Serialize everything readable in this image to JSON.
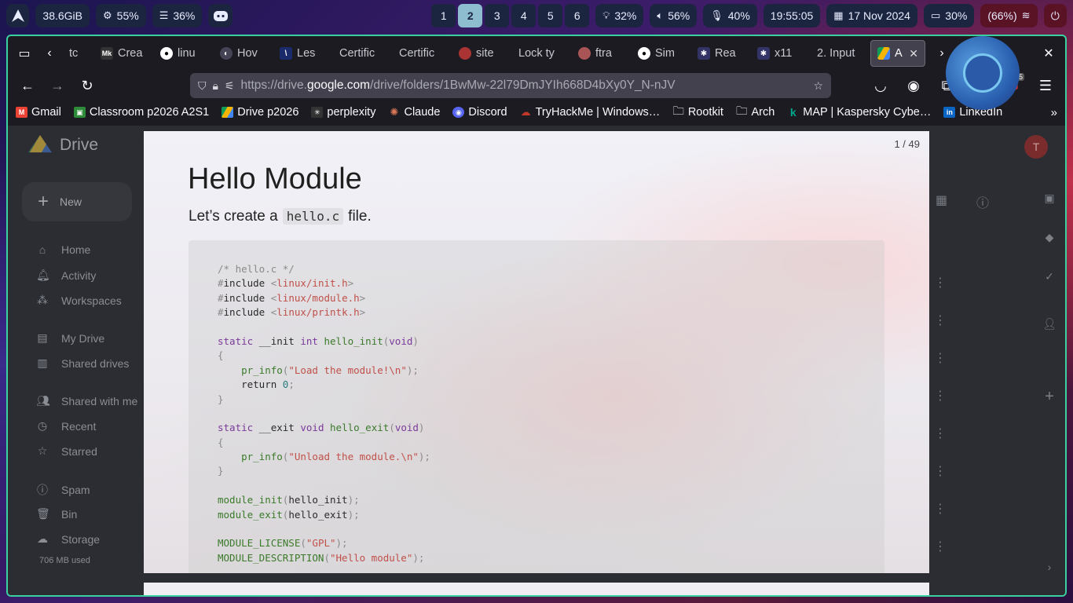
{
  "topbar": {
    "memory": "38.6GiB",
    "cpu": "55%",
    "ram": "36%",
    "workspaces": [
      "1",
      "2",
      "3",
      "4",
      "5",
      "6"
    ],
    "active_workspace": "2",
    "brightness": "32%",
    "volume": "56%",
    "mic": "40%",
    "time": "19:55:05",
    "date": "17 Nov 2024",
    "battery": "30%",
    "wifi": "(66%)"
  },
  "tabs": [
    {
      "label": "tc",
      "fav": "firefox-icon"
    },
    {
      "label": "Crea",
      "fav": "mk-icon"
    },
    {
      "label": "linu",
      "fav": "github-icon"
    },
    {
      "label": "Hov",
      "fav": "shield-icon"
    },
    {
      "label": "Les",
      "fav": "x-icon"
    },
    {
      "label": "Certific",
      "fav": ""
    },
    {
      "label": "Certific",
      "fav": ""
    },
    {
      "label": "site",
      "fav": "site-icon"
    },
    {
      "label": "Lock ty",
      "fav": ""
    },
    {
      "label": "ftra",
      "fav": "site-icon"
    },
    {
      "label": "Sim",
      "fav": "github-icon"
    },
    {
      "label": "Rea",
      "fav": "bug-icon"
    },
    {
      "label": "x11",
      "fav": "bug-icon"
    },
    {
      "label": "2. Input",
      "fav": ""
    },
    {
      "label": "A",
      "fav": "drive-icon",
      "active": true
    }
  ],
  "url": {
    "prefix": "https://drive.",
    "domain": "google.com",
    "path": "/drive/folders/1BwMw-22l79DmJYIh668D4bXy0Y_N-nJV"
  },
  "extension_badge": "75",
  "bookmarks": [
    {
      "label": "Gmail",
      "color": "#ea4335",
      "glyph": "M"
    },
    {
      "label": "Classroom p2026 A2S1",
      "color": "#2e8b3a",
      "glyph": "▣"
    },
    {
      "label": "Drive p2026",
      "color": "#f4b400",
      "glyph": "▲"
    },
    {
      "label": "perplexity",
      "color": "#333333",
      "glyph": "✳"
    },
    {
      "label": "Claude",
      "color": "#d97757",
      "glyph": "✺"
    },
    {
      "label": "Discord",
      "color": "#5865f2",
      "glyph": "◉"
    },
    {
      "label": "TryHackMe | Windows…",
      "color": "#c0392b",
      "glyph": "☁"
    },
    {
      "label": "Rootkit",
      "color": "",
      "glyph": "🗀"
    },
    {
      "label": "Arch",
      "color": "",
      "glyph": "🗀"
    },
    {
      "label": "MAP | Kaspersky Cybe…",
      "color": "#009982",
      "glyph": "k"
    },
    {
      "label": "LinkedIn",
      "color": "#0a66c2",
      "glyph": "in"
    }
  ],
  "drive": {
    "brand": "Drive",
    "new_label": "New",
    "nav": [
      "Home",
      "Activity",
      "Workspaces",
      "My Drive",
      "Shared drives",
      "Shared with me",
      "Recent",
      "Starred",
      "Spam",
      "Bin",
      "Storage"
    ],
    "storage_used": "706 MB used",
    "avatar_letter": "T"
  },
  "slide": {
    "counter": "1 / 49",
    "title": "Hello Module",
    "subtitle_pre": "Let’s create a",
    "subtitle_code": "hello.c",
    "subtitle_post": "file.",
    "code_lines": [
      [
        {
          "t": "/* hello.c */",
          "c": "com"
        }
      ],
      [
        {
          "t": "#",
          "c": "pp"
        },
        {
          "t": "include",
          "c": "plain"
        },
        {
          "t": " <",
          "c": "pp"
        },
        {
          "t": "linux/init.h",
          "c": "str"
        },
        {
          "t": ">",
          "c": "pp"
        }
      ],
      [
        {
          "t": "#",
          "c": "pp"
        },
        {
          "t": "include",
          "c": "plain"
        },
        {
          "t": " <",
          "c": "pp"
        },
        {
          "t": "linux/module.h",
          "c": "str"
        },
        {
          "t": ">",
          "c": "pp"
        }
      ],
      [
        {
          "t": "#",
          "c": "pp"
        },
        {
          "t": "include",
          "c": "plain"
        },
        {
          "t": " <",
          "c": "pp"
        },
        {
          "t": "linux/printk.h",
          "c": "str"
        },
        {
          "t": ">",
          "c": "pp"
        }
      ],
      [
        {
          "t": "",
          "c": "plain"
        }
      ],
      [
        {
          "t": "static",
          "c": "kw"
        },
        {
          "t": " __init ",
          "c": "plain"
        },
        {
          "t": "int",
          "c": "kw"
        },
        {
          "t": " ",
          "c": "plain"
        },
        {
          "t": "hello_init",
          "c": "fn"
        },
        {
          "t": "(",
          "c": "pp"
        },
        {
          "t": "void",
          "c": "kw"
        },
        {
          "t": ")",
          "c": "pp"
        }
      ],
      [
        {
          "t": "{",
          "c": "pp"
        }
      ],
      [
        {
          "t": "    ",
          "c": "plain"
        },
        {
          "t": "pr_info",
          "c": "fn"
        },
        {
          "t": "(",
          "c": "pp"
        },
        {
          "t": "\"Load the module!\\n\"",
          "c": "str"
        },
        {
          "t": ");",
          "c": "pp"
        }
      ],
      [
        {
          "t": "    return ",
          "c": "plain"
        },
        {
          "t": "0",
          "c": "num"
        },
        {
          "t": ";",
          "c": "pp"
        }
      ],
      [
        {
          "t": "}",
          "c": "pp"
        }
      ],
      [
        {
          "t": "",
          "c": "plain"
        }
      ],
      [
        {
          "t": "static",
          "c": "kw"
        },
        {
          "t": " __exit ",
          "c": "plain"
        },
        {
          "t": "void",
          "c": "kw"
        },
        {
          "t": " ",
          "c": "plain"
        },
        {
          "t": "hello_exit",
          "c": "fn"
        },
        {
          "t": "(",
          "c": "pp"
        },
        {
          "t": "void",
          "c": "kw"
        },
        {
          "t": ")",
          "c": "pp"
        }
      ],
      [
        {
          "t": "{",
          "c": "pp"
        }
      ],
      [
        {
          "t": "    ",
          "c": "plain"
        },
        {
          "t": "pr_info",
          "c": "fn"
        },
        {
          "t": "(",
          "c": "pp"
        },
        {
          "t": "\"Unload the module.\\n\"",
          "c": "str"
        },
        {
          "t": ");",
          "c": "pp"
        }
      ],
      [
        {
          "t": "}",
          "c": "pp"
        }
      ],
      [
        {
          "t": "",
          "c": "plain"
        }
      ],
      [
        {
          "t": "module_init",
          "c": "fn"
        },
        {
          "t": "(",
          "c": "pp"
        },
        {
          "t": "hello_init",
          "c": "plain"
        },
        {
          "t": ");",
          "c": "pp"
        }
      ],
      [
        {
          "t": "module_exit",
          "c": "fn"
        },
        {
          "t": "(",
          "c": "pp"
        },
        {
          "t": "hello_exit",
          "c": "plain"
        },
        {
          "t": ");",
          "c": "pp"
        }
      ],
      [
        {
          "t": "",
          "c": "plain"
        }
      ],
      [
        {
          "t": "MODULE_LICENSE",
          "c": "fn"
        },
        {
          "t": "(",
          "c": "pp"
        },
        {
          "t": "\"GPL\"",
          "c": "str"
        },
        {
          "t": ");",
          "c": "pp"
        }
      ],
      [
        {
          "t": "MODULE_DESCRIPTION",
          "c": "fn"
        },
        {
          "t": "(",
          "c": "pp"
        },
        {
          "t": "\"Hello module\"",
          "c": "str"
        },
        {
          "t": ");",
          "c": "pp"
        }
      ]
    ]
  }
}
